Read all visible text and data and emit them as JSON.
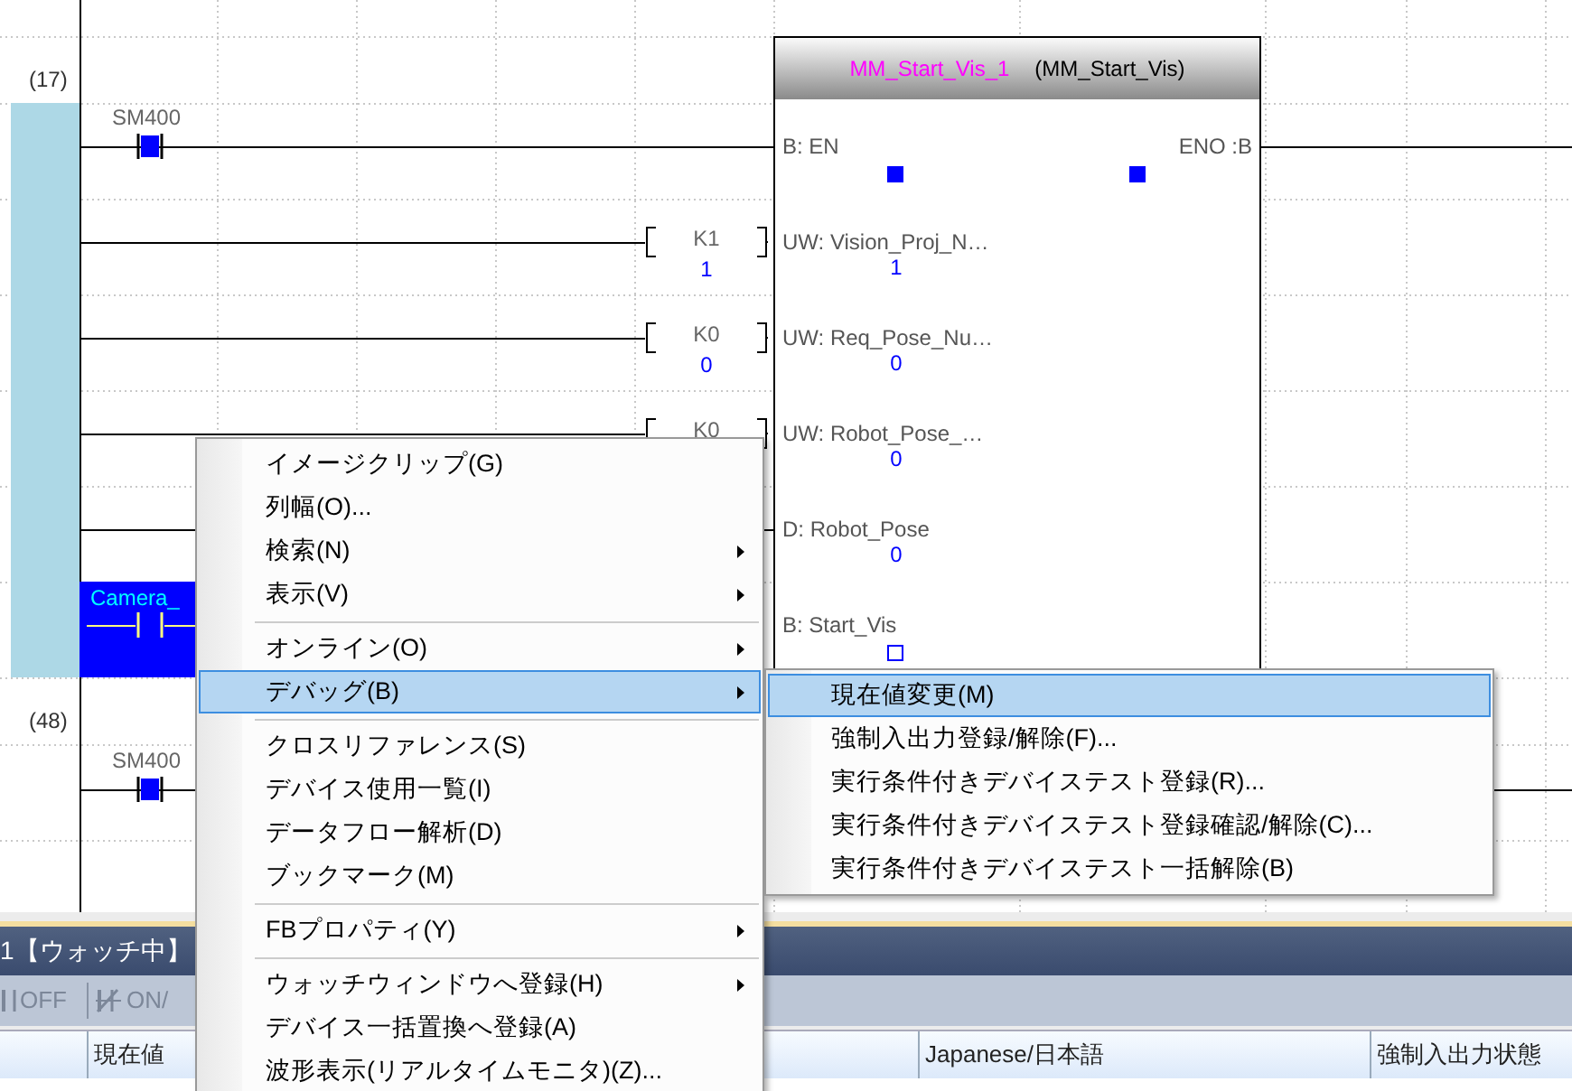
{
  "ladder": {
    "steps": [
      {
        "number": "(17)"
      },
      {
        "number": "(48)"
      }
    ],
    "contacts": [
      {
        "device": "SM400",
        "on": true
      },
      {
        "device": "Camera_",
        "selected": true
      },
      {
        "device": "SM400",
        "on": true
      }
    ],
    "constants": [
      {
        "device": "K1",
        "value": "1"
      },
      {
        "device": "K0",
        "value": "0"
      },
      {
        "device": "K0"
      }
    ],
    "function_block": {
      "instance": "MM_Start_Vis_1",
      "type": "(MM_Start_Vis)",
      "output": {
        "label": "ENO :B",
        "kind": "bit",
        "on": true
      },
      "inputs": [
        {
          "label": "B: EN",
          "kind": "bit",
          "on": true
        },
        {
          "label": "UW: Vision_Proj_N…",
          "kind": "word",
          "value": "1"
        },
        {
          "label": "UW: Req_Pose_Nu…",
          "kind": "word",
          "value": "0"
        },
        {
          "label": "UW: Robot_Pose_…",
          "kind": "word",
          "value": "0"
        },
        {
          "label": "D: Robot_Pose",
          "kind": "word",
          "value": "0"
        },
        {
          "label": "B: Start_Vis",
          "kind": "bit",
          "on": false
        }
      ]
    }
  },
  "watch_window": {
    "title": "1【ウォッチ中】",
    "toolbar": [
      "OFF",
      "ON/"
    ],
    "columns": [
      "現在値",
      "Japanese/日本語",
      "強制入出力状態"
    ]
  },
  "context_menu": {
    "items": [
      {
        "kind": "item",
        "label": "イメージクリップ(G)",
        "submenu": false,
        "selected": false
      },
      {
        "kind": "item",
        "label": "列幅(O)...",
        "submenu": false,
        "selected": false
      },
      {
        "kind": "item",
        "label": "検索(N)",
        "submenu": true,
        "selected": false
      },
      {
        "kind": "item",
        "label": "表示(V)",
        "submenu": true,
        "selected": false
      },
      {
        "kind": "separator"
      },
      {
        "kind": "item",
        "label": "オンライン(O)",
        "submenu": true,
        "selected": false
      },
      {
        "kind": "item",
        "label": "デバッグ(B)",
        "submenu": true,
        "selected": true
      },
      {
        "kind": "separator"
      },
      {
        "kind": "item",
        "label": "クロスリファレンス(S)",
        "submenu": false,
        "selected": false
      },
      {
        "kind": "item",
        "label": "デバイス使用一覧(I)",
        "submenu": false,
        "selected": false
      },
      {
        "kind": "item",
        "label": "データフロー解析(D)",
        "submenu": false,
        "selected": false
      },
      {
        "kind": "item",
        "label": "ブックマーク(M)",
        "submenu": false,
        "selected": false
      },
      {
        "kind": "separator"
      },
      {
        "kind": "item",
        "label": "FBプロパティ(Y)",
        "submenu": true,
        "selected": false
      },
      {
        "kind": "separator"
      },
      {
        "kind": "item",
        "label": "ウォッチウィンドウへ登録(H)",
        "submenu": true,
        "selected": false
      },
      {
        "kind": "item",
        "label": "デバイス一括置換へ登録(A)",
        "submenu": false,
        "selected": false
      },
      {
        "kind": "item",
        "label": "波形表示(リアルタイムモニタ)(Z)...",
        "submenu": false,
        "selected": false
      }
    ]
  },
  "debug_submenu": {
    "items": [
      {
        "label": "現在値変更(M)",
        "selected": true
      },
      {
        "label": "強制入出力登録/解除(F)...",
        "selected": false
      },
      {
        "label": "実行条件付きデバイステスト登録(R)...",
        "selected": false
      },
      {
        "label": "実行条件付きデバイステスト登録確認/解除(C)...",
        "selected": false
      },
      {
        "label": "実行条件付きデバイステスト一括解除(B)",
        "selected": false
      }
    ]
  }
}
